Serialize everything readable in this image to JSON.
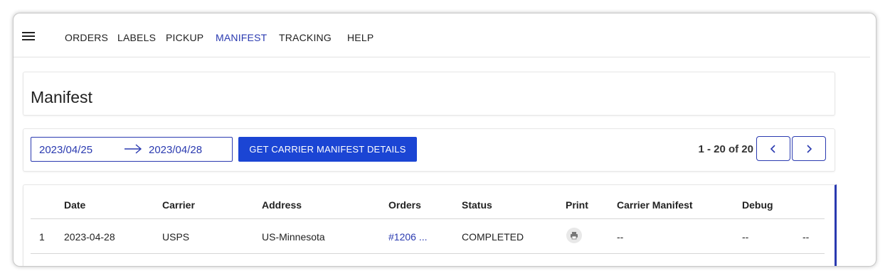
{
  "nav": {
    "items": [
      {
        "label": "ORDERS"
      },
      {
        "label": "LABELS"
      },
      {
        "label": "PICKUP"
      },
      {
        "label": "MANIFEST",
        "active": true
      },
      {
        "label": "TRACKING"
      },
      {
        "label": "HELP"
      }
    ]
  },
  "page": {
    "title": "Manifest"
  },
  "filter": {
    "start_date": "2023/04/25",
    "end_date": "2023/04/28",
    "get_button_label": "GET CARRIER MANIFEST DETAILS"
  },
  "pagination": {
    "text": "1 - 20 of 20"
  },
  "table": {
    "headers": [
      "Date",
      "Carrier",
      "Address",
      "Orders",
      "Status",
      "Print",
      "Carrier Manifest",
      "Debug"
    ],
    "rows": [
      {
        "index": "1",
        "date": "2023-04-28",
        "carrier": "USPS",
        "address": "US-Minnesota",
        "orders": "#1206 ...",
        "status": "COMPLETED",
        "carrier_manifest": "--",
        "debug": "--",
        "extra": "--"
      }
    ]
  },
  "colors": {
    "accent": "#2a3ab0",
    "button": "#1b45d4"
  },
  "icons": [
    "menu-icon",
    "arrow-right-icon",
    "chevron-left-icon",
    "chevron-right-icon",
    "printer-icon"
  ]
}
